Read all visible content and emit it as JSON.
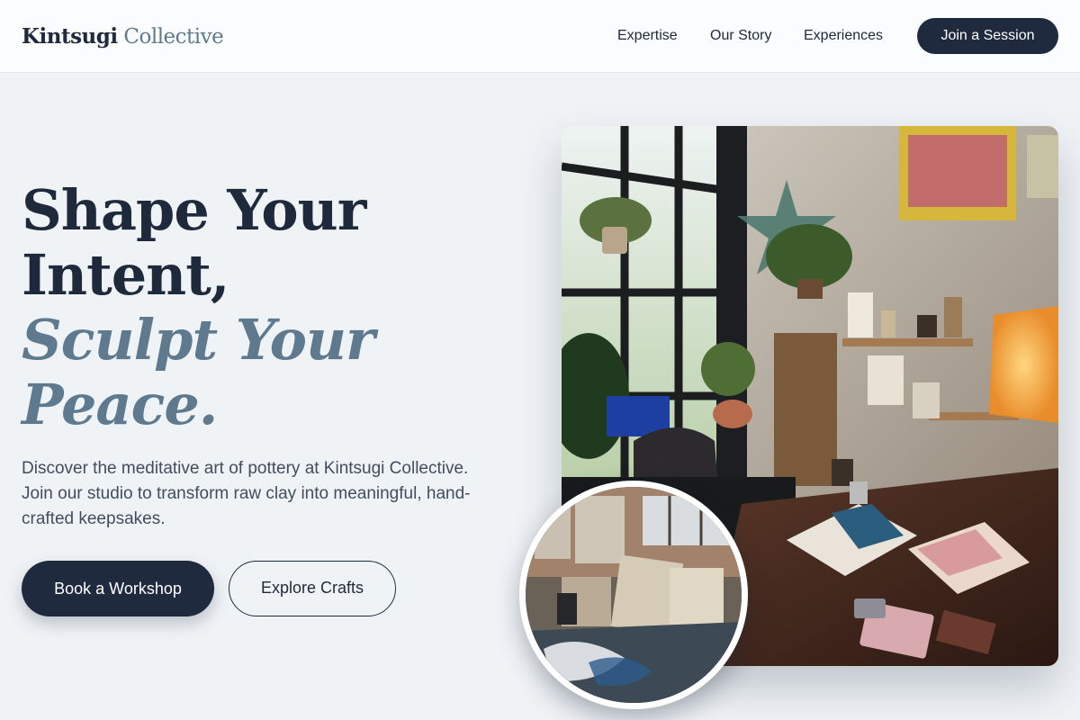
{
  "header": {
    "logo_word1": "Kintsugi",
    "logo_word2": "Collective",
    "nav": [
      "Expertise",
      "Our Story",
      "Experiences"
    ],
    "cta_label": "Join a Session"
  },
  "hero": {
    "headline_line1": "Shape Your",
    "headline_line2": "Intent,",
    "headline_line3": "Sculpt Your",
    "headline_line4": "Peace.",
    "lead": "Discover the meditative art of pottery at Kintsugi Collective. Join our studio to transform raw clay into meaningful, hand-crafted keepsakes.",
    "primary_button": "Book a Workshop",
    "secondary_button": "Explore Crafts"
  },
  "colors": {
    "navy": "#1f2a3e",
    "slate_accent": "#5f7a8f",
    "background": "#f0f3f6"
  }
}
